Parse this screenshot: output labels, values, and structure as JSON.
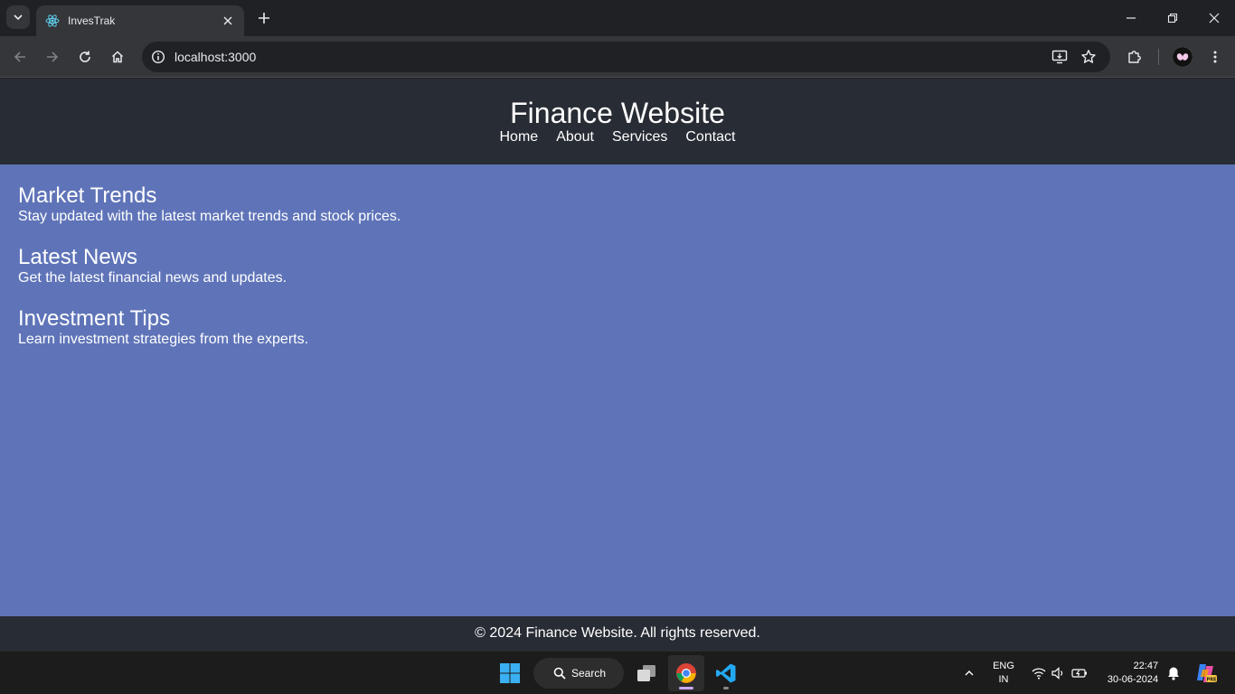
{
  "browser": {
    "tab_title": "InvesTrak",
    "url": "localhost:3000"
  },
  "site": {
    "title": "Finance Website",
    "nav": [
      "Home",
      "About",
      "Services",
      "Contact"
    ],
    "sections": [
      {
        "heading": "Market Trends",
        "text": "Stay updated with the latest market trends and stock prices."
      },
      {
        "heading": "Latest News",
        "text": "Get the latest financial news and updates."
      },
      {
        "heading": "Investment Tips",
        "text": "Learn investment strategies from the experts."
      }
    ],
    "footer": "© 2024 Finance Website. All rights reserved."
  },
  "taskbar": {
    "search_label": "Search",
    "lang_top": "ENG",
    "lang_bottom": "IN",
    "time": "22:47",
    "date": "30-06-2024"
  },
  "colors": {
    "page_bg": "#5f74b8",
    "header_bg": "#282c34",
    "chrome_bg": "#202124",
    "toolbar_bg": "#35363a"
  },
  "icons": {
    "tab_search": "chevron-down-icon",
    "favicon": "react-icon",
    "back": "arrow-left-icon",
    "forward": "arrow-right-icon",
    "reload": "reload-icon",
    "home": "home-icon",
    "site_info": "info-icon",
    "install": "install-app-icon",
    "bookmark": "star-icon",
    "extensions": "puzzle-icon",
    "menu": "kebab-menu-icon"
  }
}
